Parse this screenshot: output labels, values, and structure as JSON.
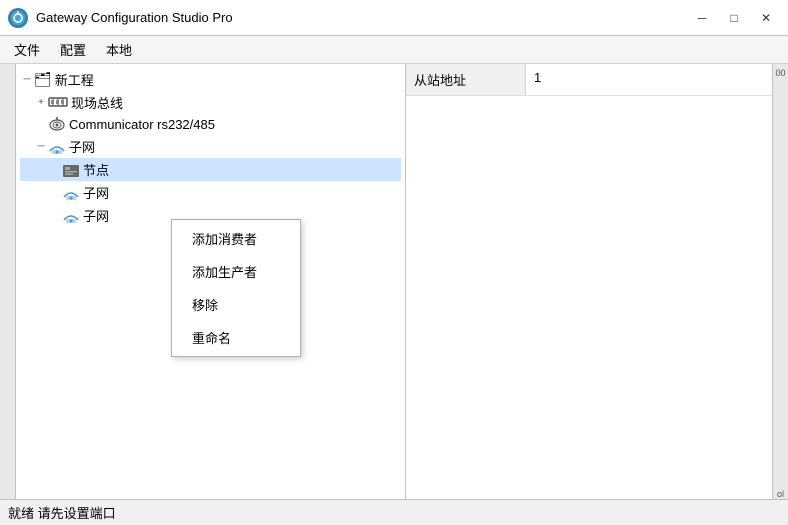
{
  "window": {
    "title": "Gateway Configuration Studio Pro",
    "icon_label": "G",
    "minimize_label": "─",
    "maximize_label": "□",
    "close_label": "✕"
  },
  "menubar": {
    "items": [
      {
        "label": "文件"
      },
      {
        "label": "配置"
      },
      {
        "label": "本地"
      }
    ]
  },
  "tree": {
    "root": {
      "label": "新工程",
      "expanded": true,
      "children": [
        {
          "label": "现场总线",
          "icon": "🔌",
          "expanded": true
        },
        {
          "label": "Communicator rs232/485",
          "icon": "📡"
        },
        {
          "label": "子网",
          "icon": "☁",
          "expanded": true,
          "children": [
            {
              "label": "节点",
              "icon": "⬛",
              "selected": true
            },
            {
              "label": "子网",
              "icon": "☁"
            },
            {
              "label": "子网",
              "icon": "☁"
            }
          ]
        }
      ]
    }
  },
  "context_menu": {
    "items": [
      {
        "label": "添加消费者"
      },
      {
        "label": "添加生产者"
      },
      {
        "label": "移除"
      },
      {
        "label": "重命名"
      }
    ]
  },
  "properties": {
    "rows": [
      {
        "label": "从站地址",
        "value": "1"
      }
    ]
  },
  "statusbar": {
    "text": "就绪 请先设置端口"
  },
  "side_hint": {
    "right_number": "00",
    "right_bottom": "ol"
  }
}
